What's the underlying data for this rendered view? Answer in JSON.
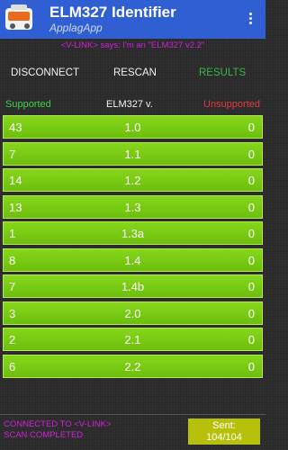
{
  "app": {
    "title": "ELM327 Identifier",
    "subtitle": "ApplagApp",
    "icon": "car-diagnostic-icon",
    "accent": "#2f5fd3"
  },
  "status_message": "<V-LINK> says: I'm an \"ELM327 v2.2\"",
  "toolbar": {
    "disconnect": "DISCONNECT",
    "rescan": "RESCAN",
    "results": "RESULTS"
  },
  "table": {
    "headers": {
      "supported": "Supported",
      "version": "ELM327 v.",
      "unsupported": "Unsupported"
    },
    "rows": [
      {
        "supported": "43",
        "version": "1.0",
        "unsupported": "0"
      },
      {
        "supported": "7",
        "version": "1.1",
        "unsupported": "0"
      },
      {
        "supported": "14",
        "version": "1.2",
        "unsupported": "0"
      },
      {
        "supported": "13",
        "version": "1.3",
        "unsupported": "0"
      },
      {
        "supported": "1",
        "version": "1.3a",
        "unsupported": "0"
      },
      {
        "supported": "8",
        "version": "1.4",
        "unsupported": "0"
      },
      {
        "supported": "7",
        "version": "1.4b",
        "unsupported": "0"
      },
      {
        "supported": "3",
        "version": "2.0",
        "unsupported": "0"
      },
      {
        "supported": "2",
        "version": "2.1",
        "unsupported": "0"
      },
      {
        "supported": "6",
        "version": "2.2",
        "unsupported": "0"
      }
    ]
  },
  "footer": {
    "connected": "CONNECTED TO <V-LINK>",
    "scan": "SCAN COMPLETED",
    "sent_label": "Sent:",
    "sent_value": "104/104"
  }
}
